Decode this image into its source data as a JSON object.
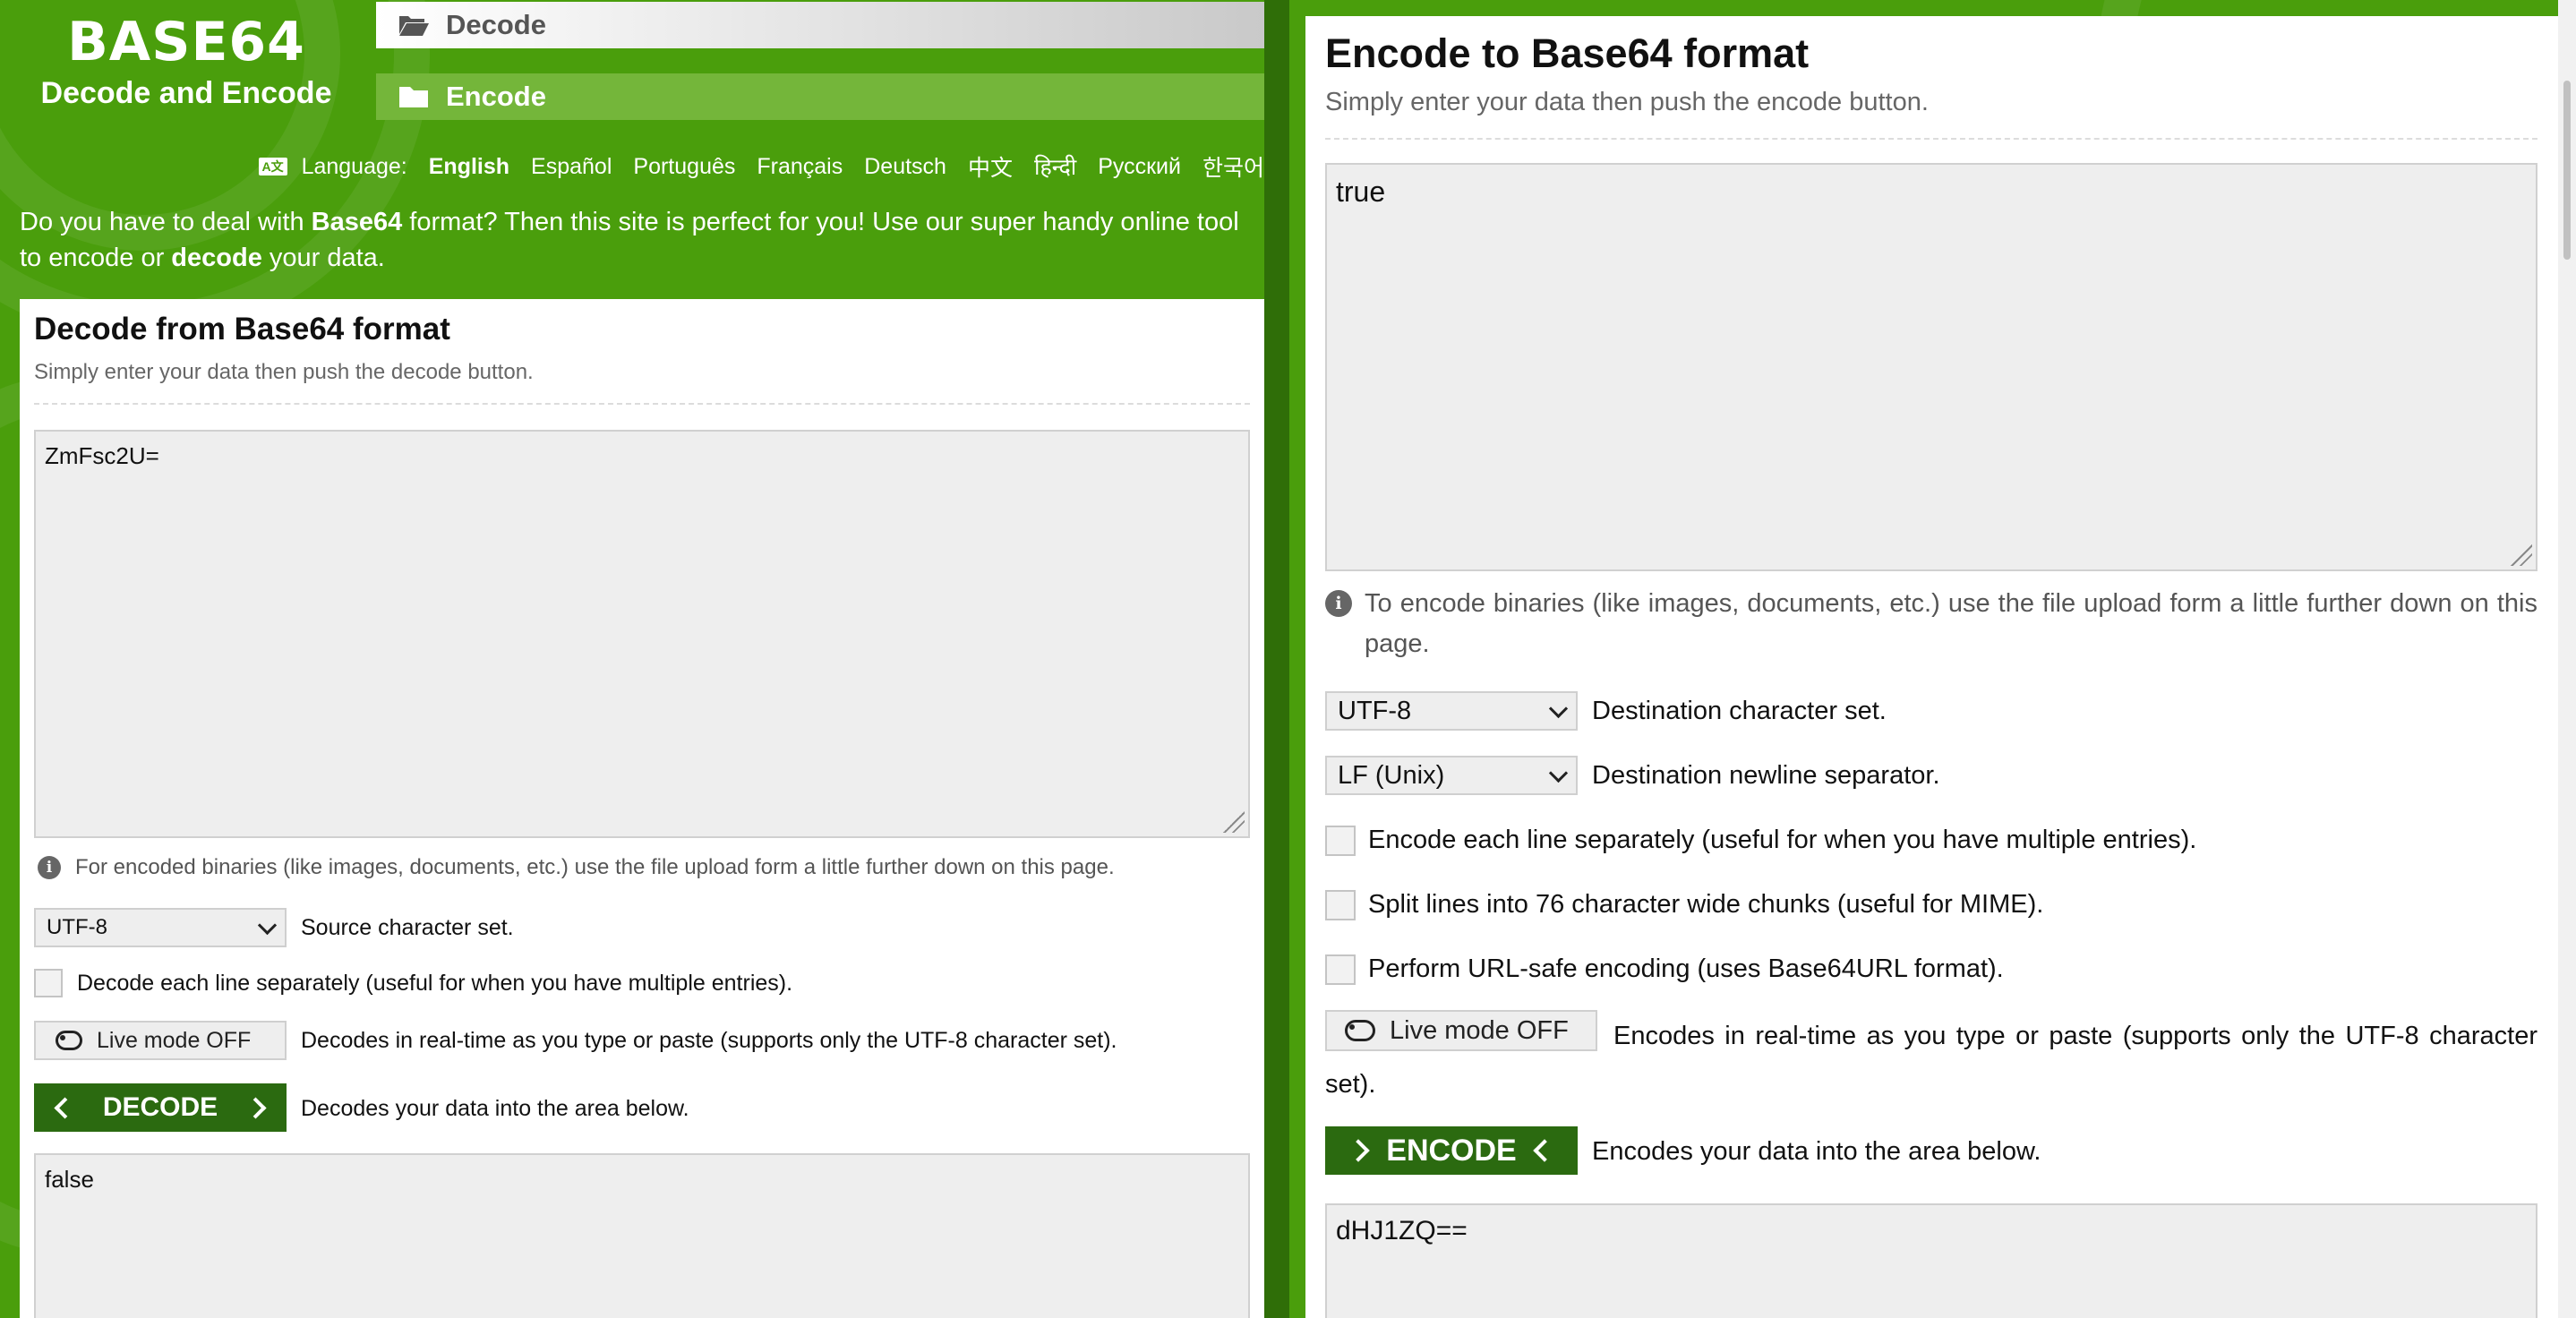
{
  "header": {
    "logo_title": "BASE64",
    "logo_subtitle": "Decode and Encode",
    "nav": {
      "decode_label": "Decode",
      "encode_label": "Encode"
    },
    "language_label": "Language:",
    "languages": [
      "English",
      "Español",
      "Português",
      "Français",
      "Deutsch",
      "中文",
      "हिन्दी",
      "Русский",
      "한국어"
    ],
    "active_language": "English",
    "intro": {
      "p1": "Do you have to deal with ",
      "b1": "Base64",
      "p2": " format? Then this site is perfect for you! Use our super handy online tool to encode or ",
      "b2": "decode",
      "p3": " your data."
    }
  },
  "decode": {
    "title": "Decode from Base64 format",
    "subtitle": "Simply enter your data then push the decode button.",
    "input_value": "ZmFsc2U=",
    "info": "For encoded binaries (like images, documents, etc.) use the file upload form a little further down on this page.",
    "charset_value": "UTF-8",
    "charset_label": "Source character set.",
    "each_line_label": "Decode each line separately (useful for when you have multiple entries).",
    "live_mode_label": "Live mode OFF",
    "live_mode_desc": "Decodes in real-time as you type or paste (supports only the UTF-8 character set).",
    "button_label": "DECODE",
    "button_desc": "Decodes your data into the area below.",
    "output_value": "false"
  },
  "encode": {
    "title": "Encode to Base64 format",
    "subtitle": "Simply enter your data then push the encode button.",
    "input_value": "true",
    "info": "To encode binaries (like images, documents, etc.) use the file upload form a little further down on this page.",
    "charset_value": "UTF-8",
    "charset_label": "Destination character set.",
    "newline_value": "LF (Unix)",
    "newline_label": "Destination newline separator.",
    "each_line_label": "Encode each line separately (useful for when you have multiple entries).",
    "split_lines_label": "Split lines into 76 character wide chunks (useful for MIME).",
    "url_safe_label": "Perform URL-safe encoding (uses Base64URL format).",
    "live_mode_label": "Live mode OFF",
    "live_mode_desc": "Encodes in real-time as you type or paste (supports only the UTF-8 character set).",
    "button_label": "ENCODE",
    "button_desc": "Encodes your data into the area below.",
    "output_value": "dHJ1ZQ=="
  },
  "icons": {
    "nav_decode": "folder-open-icon",
    "nav_encode": "folder-icon",
    "language": "language-icon",
    "info": "info-icon",
    "toggle": "toggle-off-icon"
  },
  "colors": {
    "brand_green": "#4a9e0c",
    "button_dark_green": "#2b6a10",
    "encode_tab_green": "#74b63a"
  }
}
